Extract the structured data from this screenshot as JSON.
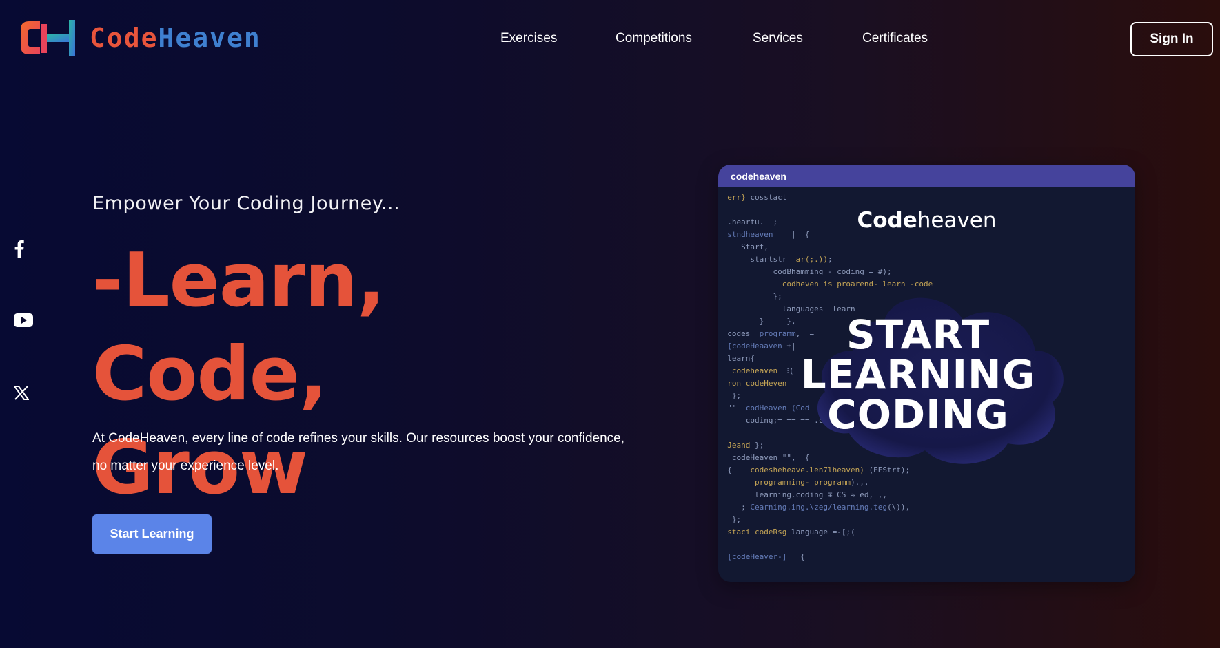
{
  "header": {
    "logo": {
      "part1": "Code",
      "part2": "Heaven"
    },
    "nav": [
      "Exercises",
      "Competitions",
      "Services",
      "Certificates"
    ],
    "signin_label": "Sign In"
  },
  "social": [
    "facebook-icon",
    "youtube-icon",
    "x-icon"
  ],
  "hero": {
    "tagline": "Empower Your Coding Journey...",
    "headline_line1": "-Learn, Code,",
    "headline_line2": "Grow",
    "description": "At CodeHeaven, every line of code refines your skills. Our resources boost your confidence, no matter your experience level.",
    "cta_label": "Start Learning"
  },
  "card": {
    "bar_title": "codeheaven",
    "brand_bold": "Code",
    "brand_rest": "heaven",
    "cloud_lines": [
      "START",
      "LEARNING",
      "CODING"
    ]
  },
  "colors": {
    "accent_orange": "#e5533a",
    "accent_blue": "#5b84e8",
    "card_bar": "#45439c"
  }
}
